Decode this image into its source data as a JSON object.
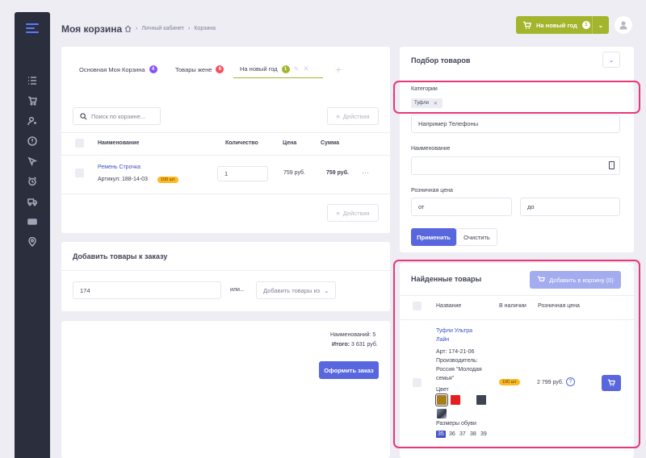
{
  "header": {
    "title": "Моя корзина",
    "breadcrumbs": [
      "Личный кабинет",
      "Корзина"
    ]
  },
  "cart_button": {
    "label": "На новый год",
    "count": "1"
  },
  "tabs": [
    {
      "label": "Основная Моя Корзина",
      "count": "4",
      "color": "#8950fc"
    },
    {
      "label": "Товары жене",
      "count": "6",
      "color": "#f64e60"
    },
    {
      "label": "На новый год",
      "count": "1",
      "color": "#a3b52c"
    }
  ],
  "cart": {
    "search_placeholder": "Поиск по корзине...",
    "actions_label": "Действия",
    "columns": {
      "name": "Наименование",
      "qty": "Количество",
      "price": "Цена",
      "sum": "Сумма"
    },
    "row": {
      "name": "Ремень Строчка",
      "sku": "Артикул: 188-14-03",
      "stock": "100 шт",
      "qty": "1",
      "price": "759 руб.",
      "sum": "759 руб.",
      "more": "···"
    }
  },
  "add_products": {
    "title": "Добавить товары к заказу",
    "value": "174",
    "or_label": "или...",
    "dropdown": "Добавить товары из"
  },
  "summary": {
    "items": "Наименований: 5",
    "total_label": "Итого:",
    "total_value": "3 631 руб.",
    "checkout": "Оформить заказ"
  },
  "filter": {
    "title": "Подбор товаров",
    "category_label": "Категории",
    "category_tag": "Туфли",
    "category_placeholder": "Например Телефоны",
    "name_label": "Наименование",
    "price_label": "Розничная цена",
    "from_placeholder": "от",
    "to_placeholder": "до",
    "apply": "Применить",
    "clear": "Очистить"
  },
  "found": {
    "title": "Найденные товары",
    "add_button": "Добавить в корзину (0)",
    "columns": {
      "name": "Название",
      "stock": "В наличии",
      "price": "Розничная цена"
    },
    "product": {
      "name_line1": "Туфли Ультра",
      "name_line2": "Лайн",
      "sku": "Арт: 174-21-06",
      "maker_line1": "Производитель:",
      "maker_line2": "Россия \"Молодая",
      "maker_line3": "семья\"",
      "stock": "100 шт",
      "price": "2 799 руб.",
      "color_label": "Цвет",
      "sizes_label": "Размеры обуви",
      "sizes": [
        "35",
        "36",
        "37",
        "38",
        "39"
      ],
      "swatches": [
        "#a87d1a",
        "#e61e1e",
        "#ffffff",
        "#3d4452"
      ]
    }
  }
}
